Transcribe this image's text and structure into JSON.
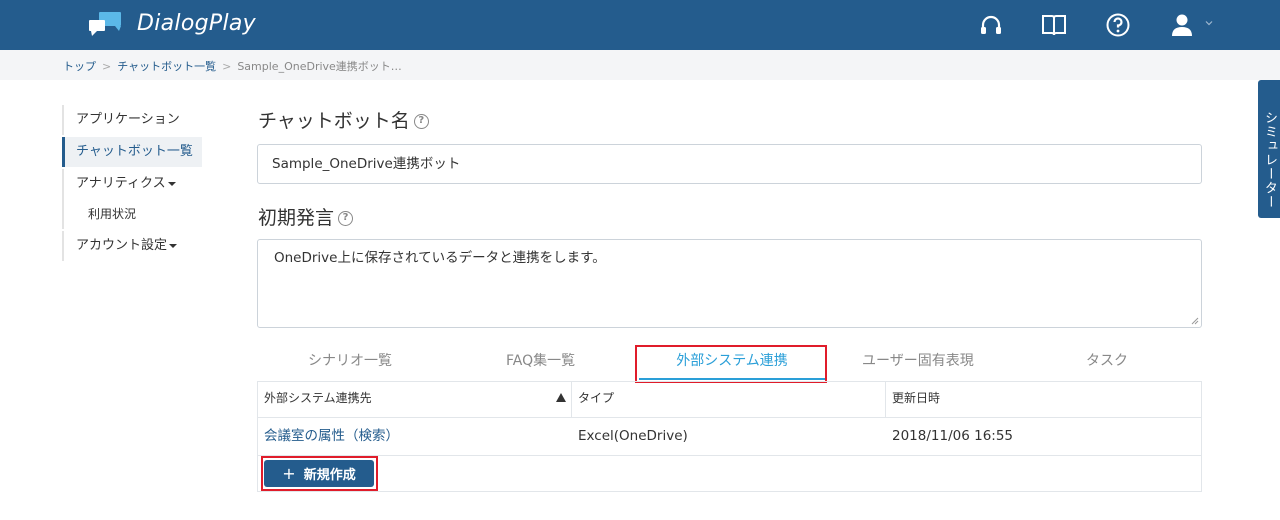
{
  "header": {
    "brand": "DialogPlay",
    "icons": [
      "headset-icon",
      "book-icon",
      "help-icon",
      "user-icon"
    ],
    "color": "#245c8d"
  },
  "breadcrumb": {
    "items": [
      "トップ",
      "チャットボット一覧"
    ],
    "current": "Sample_OneDrive連携ボット…"
  },
  "sidebar": {
    "items": [
      {
        "label": "アプリケーション"
      },
      {
        "label": "チャットボット一覧"
      },
      {
        "label": "アナリティクス"
      },
      {
        "label": "利用状況"
      },
      {
        "label": "アカウント設定"
      }
    ]
  },
  "simulator": {
    "label": "シミュレーター"
  },
  "form": {
    "name_label": "チャットボット名",
    "name_value": "Sample_OneDrive連携ボット",
    "greeting_label": "初期発言",
    "greeting_value": "OneDrive上に保存されているデータと連携をします。"
  },
  "tabs": [
    {
      "label": "シナリオ一覧"
    },
    {
      "label": "FAQ集一覧"
    },
    {
      "label": "外部システム連携"
    },
    {
      "label": "ユーザー固有表現"
    },
    {
      "label": "タスク"
    }
  ],
  "table": {
    "headers": [
      "外部システム連携先",
      "タイプ",
      "更新日時"
    ],
    "rows": [
      {
        "name": "会議室の属性（検索）",
        "type": "Excel(OneDrive)",
        "updated": "2018/11/06 16:55"
      }
    ],
    "new_button": "新規作成"
  }
}
